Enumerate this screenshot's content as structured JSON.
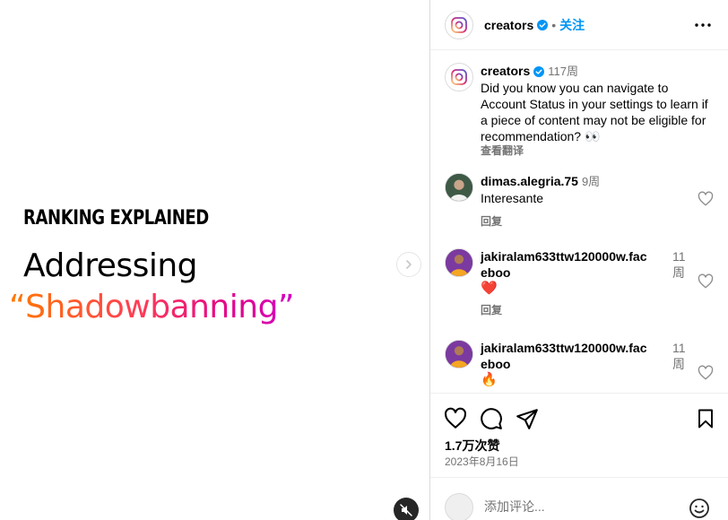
{
  "post": {
    "kicker": "RANKING EXPLAINED",
    "headline": "Addressing",
    "highlight": "“Shadowbanning”"
  },
  "header": {
    "username": "creators",
    "separator": "•",
    "follow_label": "关注"
  },
  "caption": {
    "username": "creators",
    "time": "117周",
    "text": "Did you know you can navigate to Account Status in your settings to learn if a piece of content may not be eligible for recommendation? 👀",
    "translate_label": "查看翻译"
  },
  "comments": [
    {
      "username": "dimas.alegria.75",
      "time": "9周",
      "text": "Interesante",
      "reply_label": "回复"
    },
    {
      "username_line1": "jakiralam633ttw120000w.fac",
      "username_line2": "eboo",
      "time_line1": "11",
      "time_line2": "周",
      "text": "❤️",
      "reply_label": "回复"
    },
    {
      "username_line1": "jakiralam633ttw120000w.fac",
      "username_line2": "eboo",
      "time_line1": "11",
      "time_line2": "周",
      "text": "🔥"
    }
  ],
  "stats": {
    "likes": "1.7万次赞",
    "date": "2023年8月16日"
  },
  "composer": {
    "placeholder": "添加评论..."
  },
  "colors": {
    "accent": "#0095f6",
    "verified": "#0095f6",
    "muted": "#737373"
  }
}
